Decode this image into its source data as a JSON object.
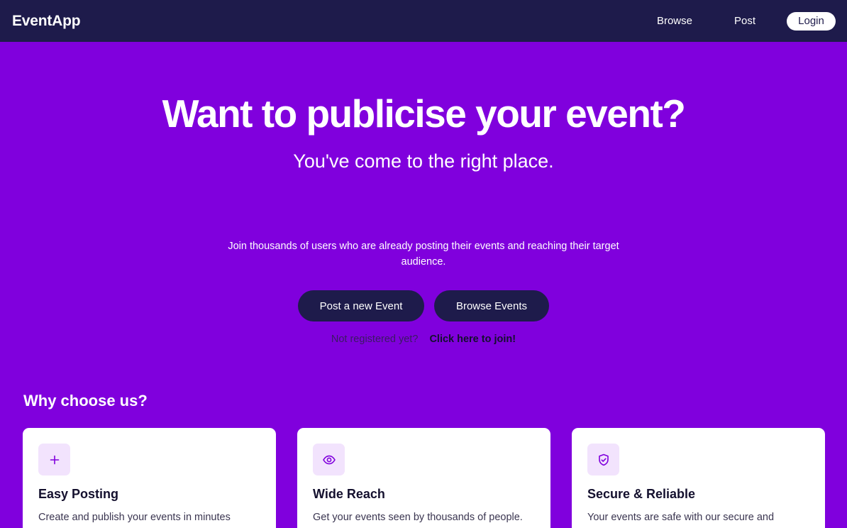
{
  "header": {
    "brand": "EventApp",
    "nav": {
      "browse": "Browse",
      "post": "Post",
      "login": "Login"
    }
  },
  "hero": {
    "title": "Want to publicise your event?",
    "subtitle": "You've come to the right place.",
    "text": "Join thousands of users who are already posting their events and reaching their target audience.",
    "buttons": {
      "post": "Post a new Event",
      "browse": "Browse Events"
    },
    "join": {
      "prompt": "Not registered yet?",
      "link": "Click here to join!"
    }
  },
  "features": {
    "heading": "Why choose us?",
    "cards": [
      {
        "icon": "plus-icon",
        "title": "Easy Posting",
        "text": "Create and publish your events in minutes"
      },
      {
        "icon": "eye-icon",
        "title": "Wide Reach",
        "text": "Get your events seen by thousands of people."
      },
      {
        "icon": "shield-check-icon",
        "title": "Secure & Reliable",
        "text": "Your events are safe with our secure and"
      }
    ]
  },
  "colors": {
    "background": "#8000dd",
    "navbar": "#1e1b4b",
    "button": "#1e1b4b",
    "card": "#ffffff",
    "icon_tile": "#f2e3fd"
  }
}
